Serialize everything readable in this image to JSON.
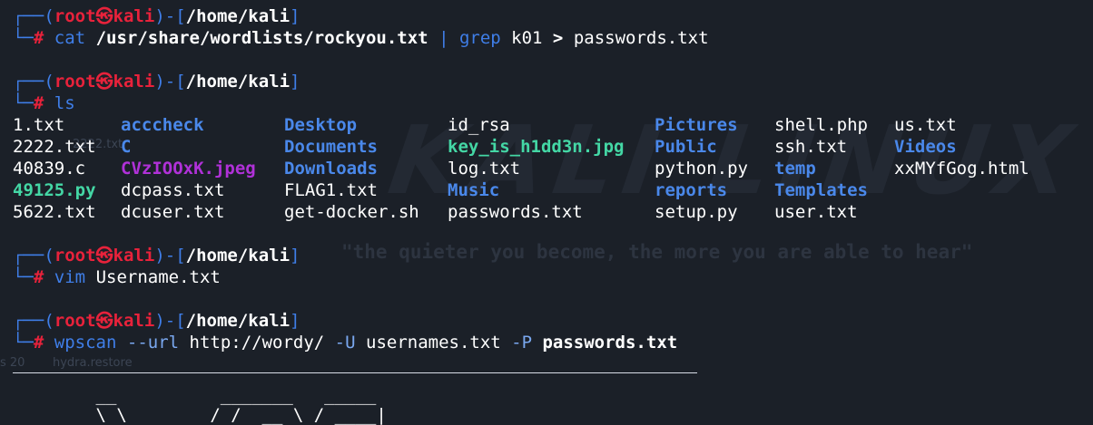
{
  "watermark": {
    "logo": "KALI LINUX",
    "tagline": "\"the quieter you become, the more you are able to hear\""
  },
  "background_ghost_text": [
    "2222.txt",
    "s 20",
    "hydra.restore"
  ],
  "prompt": {
    "bracket_open": "┌──(",
    "user": "root",
    "at_icon": "㉿",
    "host": "kali",
    "mid": ")-[",
    "path": "/home/kali",
    "bracket_close": "]",
    "second_line_prefix": "└─",
    "hash": "#"
  },
  "commands": [
    {
      "id": 1,
      "parts": [
        {
          "text": "cat",
          "style": "cmd"
        },
        {
          "text": " /usr/share/wordlists/rockyou.txt",
          "style": "b"
        },
        {
          "text": " | ",
          "style": "cmd"
        },
        {
          "text": "grep",
          "style": "cmd"
        },
        {
          "text": " k01 ",
          "style": "w"
        },
        {
          "text": ">",
          "style": "b"
        },
        {
          "text": " passwords.txt",
          "style": "w"
        }
      ]
    },
    {
      "id": 2,
      "parts": [
        {
          "text": "ls",
          "style": "cmd"
        }
      ]
    },
    {
      "id": 3,
      "parts": [
        {
          "text": "vim",
          "style": "cmd"
        },
        {
          "text": " Username.txt",
          "style": "w"
        }
      ]
    },
    {
      "id": 4,
      "parts": [
        {
          "text": "wpscan",
          "style": "cmd"
        },
        {
          "text": " --url",
          "style": "opt"
        },
        {
          "text": " http://wordy/",
          "style": "w"
        },
        {
          "text": " -U",
          "style": "opt"
        },
        {
          "text": " usernames.txt",
          "style": "w"
        },
        {
          "text": " -P",
          "style": "opt"
        },
        {
          "text": " passwords.txt",
          "style": "b"
        }
      ]
    }
  ],
  "ls_output": {
    "columns": [
      [
        {
          "name": "1.txt",
          "type": "file"
        },
        {
          "name": "2222.txt",
          "type": "file"
        },
        {
          "name": "40839.c",
          "type": "file"
        },
        {
          "name": "49125.py",
          "type": "exe"
        },
        {
          "name": "5622.txt",
          "type": "file"
        }
      ],
      [
        {
          "name": "acccheck",
          "type": "dir"
        },
        {
          "name": "C",
          "type": "dir"
        },
        {
          "name": "CVzIOOxK.jpeg",
          "type": "img"
        },
        {
          "name": "dcpass.txt",
          "type": "file"
        },
        {
          "name": "dcuser.txt",
          "type": "file"
        }
      ],
      [
        {
          "name": "Desktop",
          "type": "dir"
        },
        {
          "name": "Documents",
          "type": "dir"
        },
        {
          "name": "Downloads",
          "type": "dir"
        },
        {
          "name": "FLAG1.txt",
          "type": "file"
        },
        {
          "name": "get-docker.sh",
          "type": "file"
        }
      ],
      [
        {
          "name": "id_rsa",
          "type": "file"
        },
        {
          "name": "key_is_h1dd3n.jpg",
          "type": "exe"
        },
        {
          "name": "log.txt",
          "type": "file"
        },
        {
          "name": "Music",
          "type": "dir"
        },
        {
          "name": "passwords.txt",
          "type": "file"
        }
      ],
      [
        {
          "name": "Pictures",
          "type": "dir"
        },
        {
          "name": "Public",
          "type": "dir"
        },
        {
          "name": "python.py",
          "type": "file"
        },
        {
          "name": "reports",
          "type": "dir"
        },
        {
          "name": "setup.py",
          "type": "file"
        }
      ],
      [
        {
          "name": "shell.php",
          "type": "file"
        },
        {
          "name": "ssh.txt",
          "type": "file"
        },
        {
          "name": "temp",
          "type": "dir"
        },
        {
          "name": "Templates",
          "type": "dir"
        },
        {
          "name": "user.txt",
          "type": "file"
        }
      ],
      [
        {
          "name": "us.txt",
          "type": "file"
        },
        {
          "name": "Videos",
          "type": "dir"
        },
        {
          "name": "xxMYfGog.html",
          "type": "file"
        }
      ]
    ]
  },
  "ascii_banner": "        __          _______   _____\n        \\ \\        / /  __ \\ / ____|"
}
